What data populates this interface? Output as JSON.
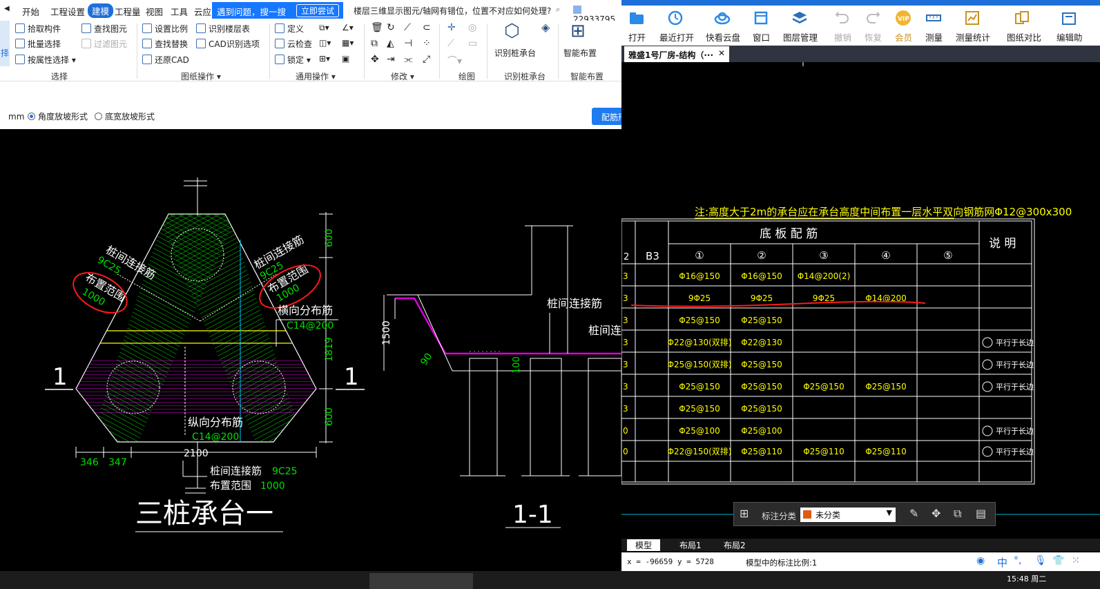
{
  "left_app": {
    "menu": [
      "开始",
      "工程设置",
      "建模",
      "工程量",
      "视图",
      "工具",
      "云应"
    ],
    "active_menu": "建模",
    "popup": {
      "text": "遇到问题，搜一搜",
      "button": "立即尝试"
    },
    "search_question": "楼层三维显示图元/轴网有错位，位置不对应如何处理?",
    "user_id": "22933795",
    "ribbon": {
      "side_label": "择",
      "select_items": [
        "拾取构件",
        "批量选择",
        "按属性选择"
      ],
      "select_items2": [
        "查找图元",
        "过滤图元"
      ],
      "select_group": "选择",
      "drawing_items": [
        "设置比例",
        "查找替换",
        "还原CAD"
      ],
      "drawing_items2": [
        "识别楼层表",
        "CAD识别选项"
      ],
      "drawing_group": "图纸操作",
      "common_items": [
        "定义",
        "云检查",
        "锁定"
      ],
      "common_group": "通用操作",
      "modify_group": "修改",
      "draw_group": "绘图",
      "pile_button": "识别桩承台",
      "pile_group": "识别桩承台",
      "smart_button": "智能布置",
      "smart_group": "智能布置"
    },
    "options": {
      "unit": "mm",
      "radio1": "角度放坡形式",
      "radio2": "底宽放坡形式",
      "button": "配筋形"
    },
    "drawing": {
      "label_conn_left": "桩间连接筋",
      "label_9c25_left": "9C25",
      "label_range_left": "布置范围",
      "label_1000_left": "1000",
      "label_conn_right": "桩间连接筋",
      "label_9c25_right": "9C25",
      "label_range_right": "布置范围",
      "label_1000_right": "1000",
      "label_trans": "横向分布筋",
      "label_c14_1": "C14@200",
      "label_long": "纵向分布筋",
      "label_c14_2": "C14@200",
      "dim_600a": "600",
      "dim_1819": "1819",
      "dim_600b": "600",
      "dim_346": "346",
      "dim_347": "347",
      "dim_2100": "2100",
      "bottom_conn": "桩间连接筋",
      "bottom_9c25": "9C25",
      "bottom_range": "布置范围",
      "bottom_1000": "1000",
      "sec_left": "1",
      "sec_right": "1",
      "title": "三桩承台一",
      "s_conn": "桩间连接筋",
      "s_conn2": "桩间连",
      "s_1500": "1500",
      "s_90": "90",
      "s_100": "100",
      "s_title": "1-1"
    }
  },
  "right_app": {
    "toolbar": [
      "打开",
      "最近打开",
      "快看云盘",
      "窗口",
      "图层管理",
      "撤销",
      "恢复",
      "会员",
      "测量",
      "测量统计",
      "图纸对比",
      "编辑助"
    ],
    "tab_title": "雅盛1号厂房-结构（···",
    "note": "注:高度大于2m的承台应在承台高度中间布置一层水平双向钢筋网Φ12@300x300",
    "table": {
      "header_main": "底 板 配 筋",
      "header_note": "说 明",
      "col_left": "2",
      "col_b3": "B3",
      "cols": [
        "①",
        "②",
        "③",
        "④",
        "⑤"
      ],
      "rows": [
        {
          "k": "3",
          "c": [
            "Φ16@150",
            "Φ16@150",
            "Φ14@200(2)",
            "",
            ""
          ],
          "n": ""
        },
        {
          "k": "3",
          "c": [
            "9Φ25",
            "9Φ25",
            "9Φ25",
            "Φ14@200",
            ""
          ],
          "n": ""
        },
        {
          "k": "3",
          "c": [
            "Φ25@150",
            "Φ25@150",
            "",
            "",
            ""
          ],
          "n": ""
        },
        {
          "k": "3",
          "c": [
            "Φ22@130(双排)",
            "Φ22@130",
            "",
            "",
            ""
          ],
          "n": "平行于长边"
        },
        {
          "k": "3",
          "c": [
            "Φ25@150(双排)",
            "Φ25@150",
            "",
            "",
            ""
          ],
          "n": "平行于长边"
        },
        {
          "k": "3",
          "c": [
            "Φ25@150",
            "Φ25@150",
            "Φ25@150",
            "Φ25@150",
            ""
          ],
          "n": "平行于长边"
        },
        {
          "k": "3",
          "c": [
            "Φ25@150",
            "Φ25@150",
            "",
            "",
            ""
          ],
          "n": ""
        },
        {
          "k": "0",
          "c": [
            "Φ25@100",
            "Φ25@100",
            "",
            "",
            ""
          ],
          "n": "平行于长边"
        },
        {
          "k": "0",
          "c": [
            "Φ22@150(双排)",
            "Φ25@110",
            "Φ25@110",
            "Φ25@110",
            ""
          ],
          "n": "平行于长边"
        }
      ]
    },
    "floatbar": {
      "label": "标注分类",
      "select": "未分类"
    },
    "layouts": [
      "模型",
      "布局1",
      "布局2"
    ],
    "status": {
      "coords": "x = -96659  y = 5728",
      "scale": "模型中的标注比例:1"
    },
    "ime": [
      "中"
    ],
    "clock": "15:48 周二"
  },
  "colors": {
    "accent": "#1e6fd9",
    "cad_green": "#00e000",
    "cad_yellow": "#ffff00",
    "cad_magenta": "#e000e0",
    "annot_red": "#ff1a1a"
  }
}
